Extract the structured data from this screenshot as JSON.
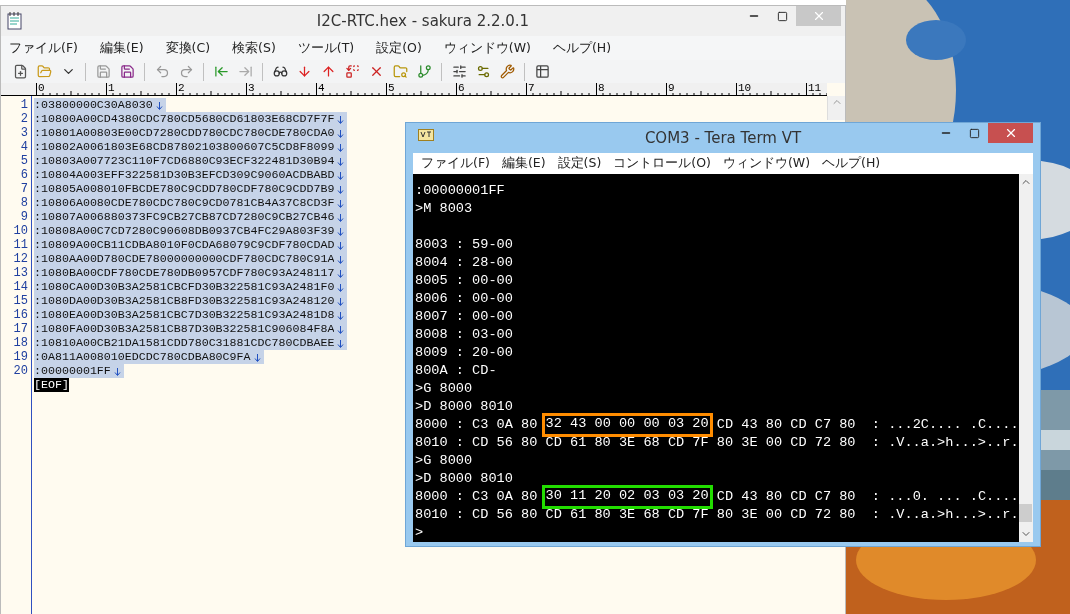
{
  "editor": {
    "title": "I2C-RTC.hex - sakura 2.2.0.1",
    "active": false,
    "menu": [
      "ファイル(F)",
      "編集(E)",
      "変換(C)",
      "検索(S)",
      "ツール(T)",
      "設定(O)",
      "ウィンドウ(W)",
      "ヘルプ(H)"
    ],
    "ruler": [
      "0",
      "1",
      "2",
      "3",
      "4",
      "5",
      "6",
      "7",
      "8",
      "9",
      "10",
      "11"
    ],
    "lines": [
      {
        "number": "1",
        "text": ":03800000C30A8030",
        "selected": true
      },
      {
        "number": "2",
        "text": ":10800A00CD4380CDC780CD5680CD61803E68CD7F7F",
        "selected": true
      },
      {
        "number": "3",
        "text": ":10801A00803E00CD7280CDD780CDC780CDE780CDA0",
        "selected": true
      },
      {
        "number": "4",
        "text": ":10802A0061803E68CD87802103800607C5CD8F8099",
        "selected": true
      },
      {
        "number": "5",
        "text": ":10803A007723C110F7CD6880C93ECF322481D30B94",
        "selected": true
      },
      {
        "number": "6",
        "text": ":10804A003EFF322581D30B3EFCD309C9060ACDBABD",
        "selected": true
      },
      {
        "number": "7",
        "text": ":10805A008010FBCDE780C9CDD780CDF780C9CDD7B9",
        "selected": true
      },
      {
        "number": "8",
        "text": ":10806A0080CDE780CDC780C9CD0781CB4A37C8CD3F",
        "selected": true
      },
      {
        "number": "9",
        "text": ":10807A006880373FC9CB27CB87CD7280C9CB27CB46",
        "selected": true
      },
      {
        "number": "10",
        "text": ":10808A00C7CD7280C90608DB0937CB4FC29A803F39",
        "selected": true
      },
      {
        "number": "11",
        "text": ":10809A00CB11CDBA8010F0CDA68079C9CDF780CDAD",
        "selected": true
      },
      {
        "number": "12",
        "text": ":1080AA00D780CDE78000000000CDF780CDC780C91A",
        "selected": true
      },
      {
        "number": "13",
        "text": ":1080BA00CDF780CDE780DB0957CDF780C93A248117",
        "selected": true
      },
      {
        "number": "14",
        "text": ":1080CA00D30B3A2581CBCFD30B322581C93A2481F0",
        "selected": true
      },
      {
        "number": "15",
        "text": ":1080DA00D30B3A2581CB8FD30B322581C93A248120",
        "selected": true
      },
      {
        "number": "16",
        "text": ":1080EA00D30B3A2581CBC7D30B322581C93A2481D8",
        "selected": true
      },
      {
        "number": "17",
        "text": ":1080FA00D30B3A2581CB87D30B322581C906084F8A",
        "selected": true
      },
      {
        "number": "18",
        "text": ":10810A00CB21DA1581CDD780C31881CDC780CDBAEE",
        "selected": true
      },
      {
        "number": "19",
        "text": ":0A811A008010EDCDC780CDBA80C9FA",
        "selected": true
      },
      {
        "number": "20",
        "text": ":00000001FF",
        "selected": true
      }
    ],
    "eof": "[EOF]"
  },
  "terminal": {
    "title": "COM3 - Tera Term VT",
    "active": true,
    "menu": [
      "ファイル(F)",
      "編集(E)",
      "設定(S)",
      "コントロール(O)",
      "ウィンドウ(W)",
      "ヘルプ(H)"
    ],
    "lines": [
      {
        "kind": "text",
        "text": ":00000001FF"
      },
      {
        "kind": "text",
        "text": ">M 8003"
      },
      {
        "kind": "blank"
      },
      {
        "kind": "text",
        "text": "8003 : 59-00"
      },
      {
        "kind": "text",
        "text": "8004 : 28-00"
      },
      {
        "kind": "text",
        "text": "8005 : 00-00"
      },
      {
        "kind": "text",
        "text": "8006 : 00-00"
      },
      {
        "kind": "text",
        "text": "8007 : 00-00"
      },
      {
        "kind": "text",
        "text": "8008 : 03-00"
      },
      {
        "kind": "text",
        "text": "8009 : 20-00"
      },
      {
        "kind": "text",
        "text": "800A : CD-"
      },
      {
        "kind": "text",
        "text": ">G 8000"
      },
      {
        "kind": "text",
        "text": ">D 8000 8010"
      },
      {
        "kind": "marked",
        "before": "8000 : C3 0A 80 ",
        "marked": "32 43 00 00 00 03 20",
        "after": " CD 43 80 CD C7 80  : ...2C.... .C....",
        "color": "#ff8c00"
      },
      {
        "kind": "text",
        "text": "8010 : CD 56 80 CD 61 80 3E 68 CD 7F 80 3E 00 CD 72 80  : .V..a.>h...>..r."
      },
      {
        "kind": "text",
        "text": ">G 8000"
      },
      {
        "kind": "text",
        "text": ">D 8000 8010"
      },
      {
        "kind": "marked",
        "before": "8000 : C3 0A 80 ",
        "marked": "30 11 20 02 03 03 20",
        "after": " CD 43 80 CD C7 80  : ...0. ... .C....",
        "color": "#22dd00"
      },
      {
        "kind": "text",
        "text": "8010 : CD 56 80 CD 61 80 3E 68 CD 7F 80 3E 00 CD 72 80  : .V..a.>h...>..r."
      },
      {
        "kind": "text",
        "text": ">"
      }
    ]
  }
}
